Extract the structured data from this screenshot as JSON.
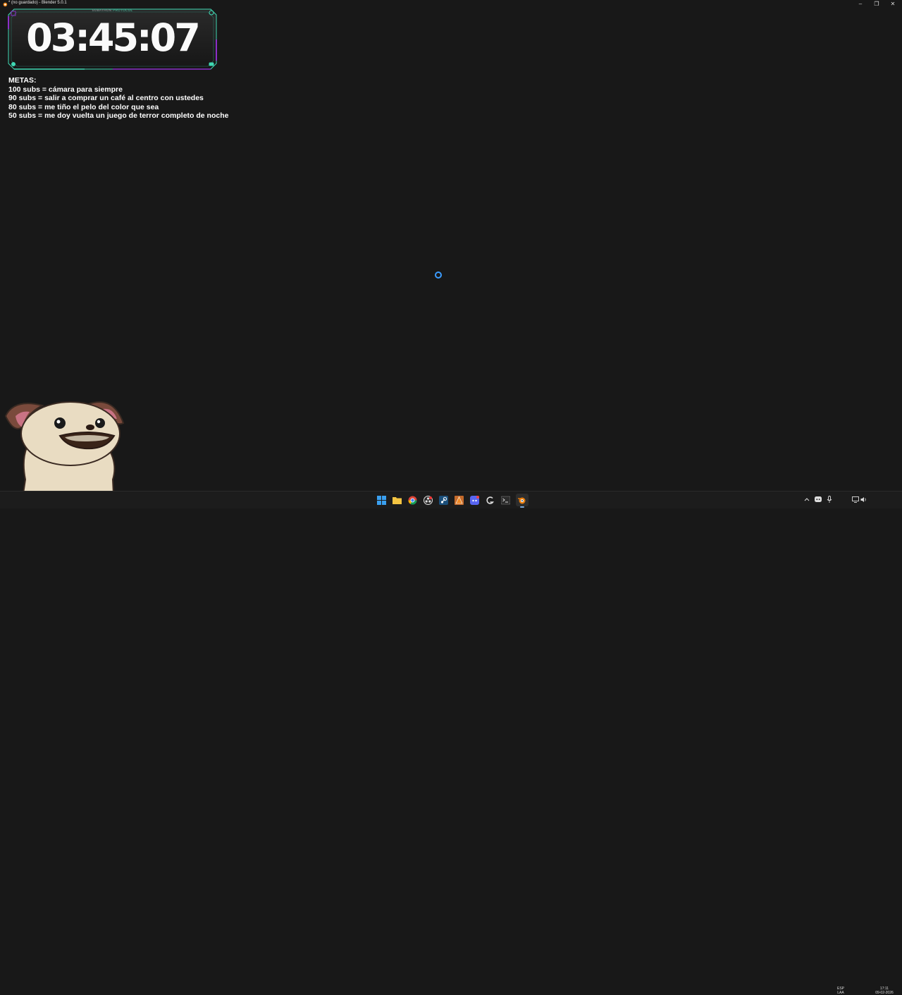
{
  "window": {
    "title": "* (no guardado) - Blender 5.0.1",
    "controls": {
      "minimize": "–",
      "restore": "❐",
      "close": "✕"
    }
  },
  "timer": {
    "tag_primary": "SUBATHON",
    "tag_accent": "PROTOCOL",
    "value": "03:45:07",
    "frame_color": "#3fd9b4",
    "accent_color": "#8b2fc9"
  },
  "goals": {
    "heading": "METAS:",
    "items": [
      "100 subs = cámara para siempre",
      "90 subs = salir a comprar un café al centro con ustedes",
      "80 subs = me tiño el pelo del color que sea",
      "50 subs = me doy vuelta un juego de terror completo de noche"
    ]
  },
  "taskbar": {
    "apps": [
      {
        "name": "start-menu-icon"
      },
      {
        "name": "file-explorer-icon"
      },
      {
        "name": "chrome-icon"
      },
      {
        "name": "obs-icon"
      },
      {
        "name": "steam-icon"
      },
      {
        "name": "vlc-icon"
      },
      {
        "name": "discord-icon"
      },
      {
        "name": "g-app-icon"
      },
      {
        "name": "terminal-icon"
      },
      {
        "name": "blender-icon"
      }
    ],
    "tray": {
      "language": "ESP",
      "layout": "LAA",
      "time": "17:11",
      "date": "09-02-2026"
    }
  }
}
